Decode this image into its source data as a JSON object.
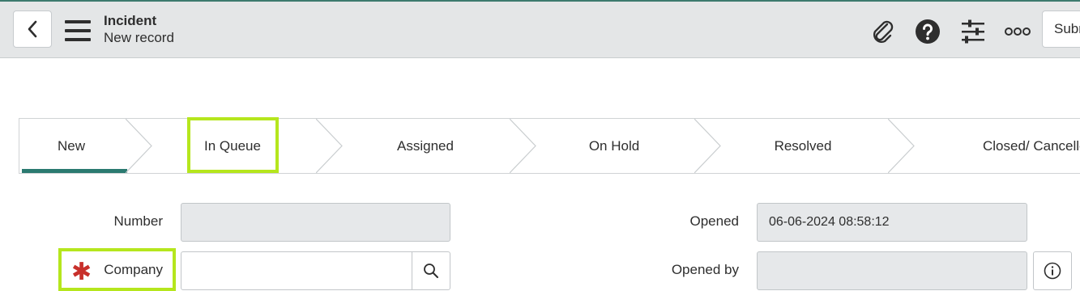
{
  "header": {
    "title": "Incident",
    "subtitle": "New record",
    "submit_label": "Submit",
    "icons": [
      "chevron-left-icon",
      "hamburger-menu-icon",
      "paperclip-icon",
      "help-icon",
      "sliders-icon",
      "more-options-icon"
    ]
  },
  "stages": [
    {
      "label": "New",
      "active": true
    },
    {
      "label": "In Queue",
      "active": false
    },
    {
      "label": "Assigned",
      "active": false
    },
    {
      "label": "On Hold",
      "active": false
    },
    {
      "label": "Resolved",
      "active": false
    },
    {
      "label": "Closed/ Cancelled",
      "active": false
    }
  ],
  "form": {
    "number": {
      "label": "Number",
      "value": ""
    },
    "company": {
      "label": "Company",
      "value": "",
      "required": true
    },
    "opened": {
      "label": "Opened",
      "value": "06-06-2024 08:58:12"
    },
    "opened_by": {
      "label": "Opened by",
      "value": ""
    }
  },
  "colors": {
    "header_bg": "#e4e6e7",
    "accent": "#2b7a70",
    "highlight": "#b5e61d",
    "required": "#c8302b",
    "readonly_bg": "#e6e8ea"
  }
}
